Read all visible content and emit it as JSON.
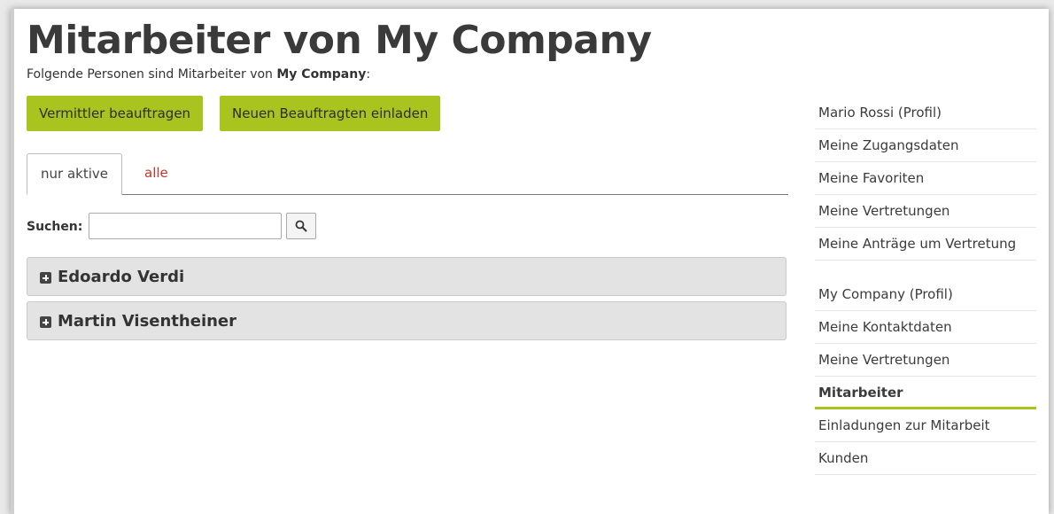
{
  "page": {
    "title": "Mitarbeiter von My Company",
    "subtitle_prefix": "Folgende Personen sind Mitarbeiter von ",
    "subtitle_company": "My Company",
    "subtitle_suffix": ":"
  },
  "actions": {
    "assign_agent": "Vermittler beauftragen",
    "invite_agent": "Neuen Beauftragten einladen"
  },
  "tabs": {
    "active": "nur aktive",
    "all": "alle"
  },
  "search": {
    "label": "Suchen:",
    "value": "",
    "placeholder": ""
  },
  "employees": [
    {
      "name": "Edoardo Verdi"
    },
    {
      "name": "Martin Visentheiner"
    }
  ],
  "sidebar": {
    "user_group": [
      {
        "label": "Mario Rossi (Profil)"
      },
      {
        "label": "Meine Zugangsdaten"
      },
      {
        "label": "Meine Favoriten"
      },
      {
        "label": "Meine Vertretungen"
      },
      {
        "label": "Meine Anträge um Vertretung"
      }
    ],
    "company_group": [
      {
        "label": "My Company (Profil)"
      },
      {
        "label": "Meine Kontaktdaten"
      },
      {
        "label": "Meine Vertretungen"
      },
      {
        "label": "Mitarbeiter",
        "active": true
      },
      {
        "label": "Einladungen zur Mitarbeit"
      },
      {
        "label": "Kunden"
      }
    ]
  },
  "colors": {
    "accent": "#a9c41f",
    "link_red": "#c0392b"
  }
}
